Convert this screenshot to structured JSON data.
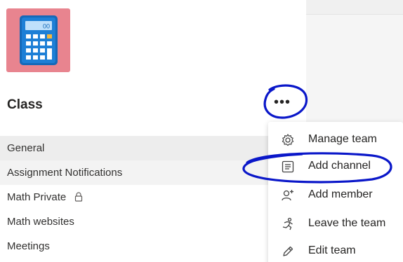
{
  "team": {
    "name": "Class",
    "avatar_icon": "calculator-icon",
    "avatar_color": "#e8848f",
    "more_label": "•••"
  },
  "channels": [
    {
      "label": "General",
      "state": "selected"
    },
    {
      "label": "Assignment Notifications",
      "state": "hover"
    },
    {
      "label": "Math Private",
      "state": "normal",
      "private": true
    },
    {
      "label": "Math websites",
      "state": "normal"
    },
    {
      "label": "Meetings",
      "state": "normal"
    }
  ],
  "menu": {
    "items": [
      {
        "label": "Manage team",
        "icon": "gear-icon"
      },
      {
        "label": "Add channel",
        "icon": "channel-list-icon"
      },
      {
        "label": "Add member",
        "icon": "add-person-icon"
      },
      {
        "label": "Leave the team",
        "icon": "running-person-icon"
      },
      {
        "label": "Edit team",
        "icon": "pencil-icon"
      }
    ]
  },
  "colors": {
    "annotation_ink": "#0a17c9",
    "selected_row": "#ededed",
    "text": "#252423"
  }
}
